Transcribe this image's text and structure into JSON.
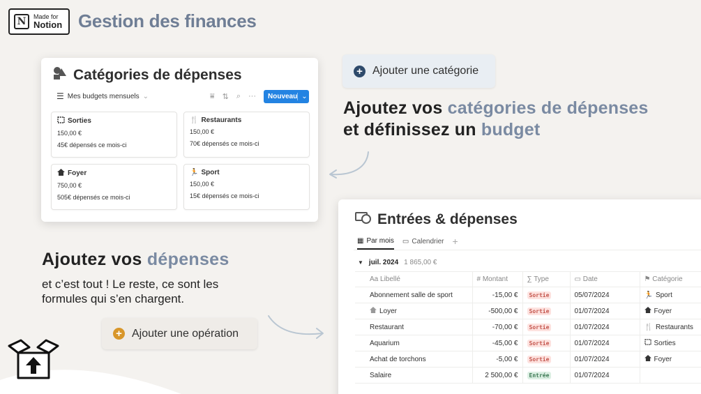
{
  "header": {
    "badge_small": "Made for",
    "badge_big": "Notion",
    "title": "Gestion des finances"
  },
  "categories_card": {
    "title": "Catégories de dépenses",
    "view_label": "Mes budgets mensuels",
    "new_button": "Nouveau",
    "items": [
      {
        "name": "Sorties",
        "icon": "ticket-icon",
        "budget": "150,00 €",
        "spent": "45€ dépensés ce mois-ci"
      },
      {
        "name": "Restaurants",
        "icon": "restaurant-icon",
        "budget": "150,00 €",
        "spent": "70€ dépensés ce mois-ci"
      },
      {
        "name": "Foyer",
        "icon": "house-icon",
        "budget": "750,00 €",
        "spent": "505€ dépensés ce mois-ci"
      },
      {
        "name": "Sport",
        "icon": "running-icon",
        "budget": "150,00 €",
        "spent": "15€ dépensés ce mois-ci"
      }
    ]
  },
  "add_category_button": "Ajouter une catégorie",
  "caption1": {
    "p1": "Ajoutez vos ",
    "a1": "catégories de dépenses",
    "p2": " et définissez un ",
    "a2": "budget"
  },
  "caption2": {
    "p1": "Ajoutez vos ",
    "a1": "dépenses",
    "sub": "et c’est tout ! Le reste, ce sont les formules qui s’en chargent."
  },
  "add_operation_button": "Ajouter une opération",
  "entries_card": {
    "title": "Entrées & dépenses",
    "tabs": [
      "Par mois",
      "Calendrier"
    ],
    "group": {
      "name": "juil. 2024",
      "sum": "1 865,00 €"
    },
    "columns": [
      "Libellé",
      "Montant",
      "Type",
      "Date",
      "Catégorie"
    ],
    "column_prefixes": [
      "Aa",
      "#",
      "∑",
      "▭",
      "⚑"
    ],
    "rows": [
      {
        "label": "Abonnement salle de sport",
        "amount": "-15,00 €",
        "type": "Sortie",
        "date": "05/07/2024",
        "category": "Sport"
      },
      {
        "label": "Loyer",
        "amount": "-500,00 €",
        "type": "Sortie",
        "date": "01/07/2024",
        "category": "Foyer"
      },
      {
        "label": "Restaurant",
        "amount": "-70,00 €",
        "type": "Sortie",
        "date": "01/07/2024",
        "category": "Restaurants"
      },
      {
        "label": "Aquarium",
        "amount": "-45,00 €",
        "type": "Sortie",
        "date": "01/07/2024",
        "category": "Sorties"
      },
      {
        "label": "Achat de torchons",
        "amount": "-5,00 €",
        "type": "Sortie",
        "date": "01/07/2024",
        "category": "Foyer"
      },
      {
        "label": "Salaire",
        "amount": "2 500,00 €",
        "type": "Entrée",
        "date": "01/07/2024",
        "category": ""
      }
    ]
  },
  "colors": {
    "accent": "#7a8aa2",
    "notion_blue": "#2383e2",
    "add_category_icon": "#2e4a6b",
    "add_operation_icon": "#d8962a",
    "tag_out_bg": "#fde2df",
    "tag_in_bg": "#dcefe3"
  }
}
